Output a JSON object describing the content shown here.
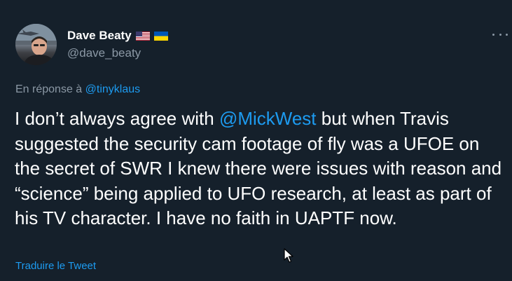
{
  "author": {
    "display_name": "Dave Beaty",
    "handle": "@dave_beaty",
    "flags": [
      "us-flag-icon",
      "ukraine-flag-icon"
    ]
  },
  "reply": {
    "prefix": "En réponse à",
    "mention": "@tinyklaus"
  },
  "tweet": {
    "part1": "I don’t always agree with ",
    "mention": "@MickWest",
    "part2": " but when Travis suggested the security cam footage of fly was a UFOE on the secret of SWR I knew there were issues with reason and “science” being applied to UFO research, at least as part of his TV character. I have no faith in UAPTF now."
  },
  "actions": {
    "translate": "Traduire le Tweet",
    "more": "more-options-icon"
  },
  "colors": {
    "background": "#15202b",
    "text": "#ffffff",
    "secondary": "#8b98a5",
    "accent": "#1d9bf0"
  }
}
